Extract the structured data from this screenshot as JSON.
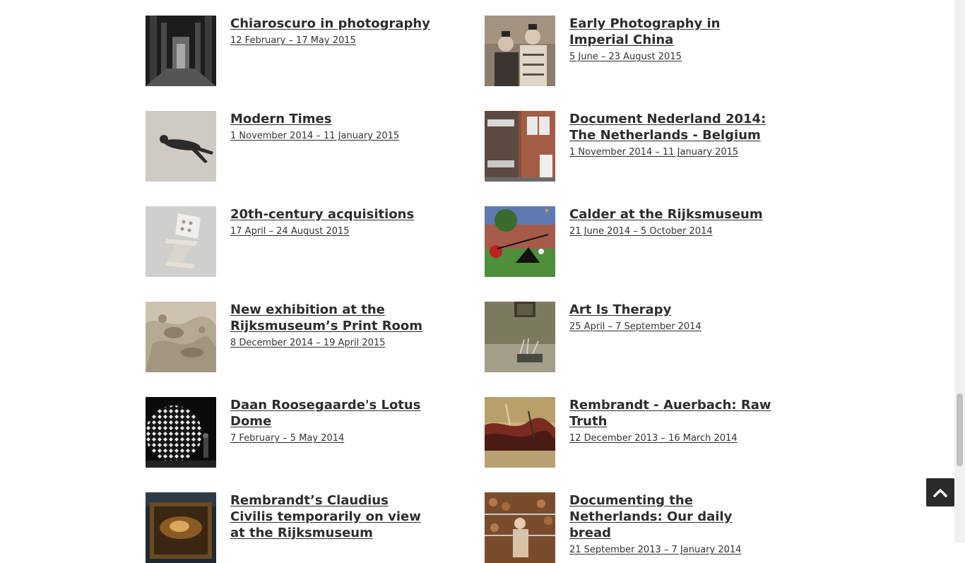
{
  "exhibitions": [
    {
      "title": "Chiaroscuro in photography",
      "date": "12 February – 17 May 2015",
      "thumb": "arched-hall-photo"
    },
    {
      "title": "Early Photography in Imperial China",
      "date": "5 June – 23 August 2015",
      "thumb": "two-women-portrait-photo"
    },
    {
      "title": "Modern Times",
      "date": "1 November 2014 – 11 January 2015",
      "thumb": "floating-figure-photo"
    },
    {
      "title": "Document Nederland 2014: The Netherlands - Belgium",
      "date": "1 November 2014 – 11 January 2015",
      "thumb": "brick-houses-photo"
    },
    {
      "title": "20th-century acquisitions",
      "date": "17 April – 24 August 2015",
      "thumb": "zigzag-chair-photo"
    },
    {
      "title": "Calder at the Rijksmuseum",
      "date": "21 June 2014 – 5 October 2014",
      "thumb": "calder-sculpture-photo"
    },
    {
      "title": "New exhibition at the Rijksmuseum’s Print Room",
      "date": "8 December 2014 – 19 April 2015",
      "thumb": "engraving-figures-image"
    },
    {
      "title": "Art Is Therapy",
      "date": "25 April – 7 September 2014",
      "thumb": "gallery-interior-photo"
    },
    {
      "title": "Daan Roosegaarde's Lotus Dome",
      "date": "7 February – 5 May 2014",
      "thumb": "lotus-dome-photo"
    },
    {
      "title": "Rembrandt - Auerbach: Raw Truth",
      "date": "12 December 2013 – 16 March 2014",
      "thumb": "abstract-painting-image"
    },
    {
      "title": "Rembrandt’s Claudius Civilis temporarily on view at the Rijksmuseum",
      "date": "",
      "thumb": "framed-painting-photo"
    },
    {
      "title": "Documenting the Netherlands: Our daily bread",
      "date": "21 September 2013 – 7 January 2014",
      "thumb": "poultry-farm-photo"
    }
  ],
  "colors": {
    "title": "#2d2d2d",
    "date": "#333333",
    "back_to_top_bg": "#2b2b2b"
  },
  "back_to_top": {
    "icon": "chevron-up-icon"
  }
}
